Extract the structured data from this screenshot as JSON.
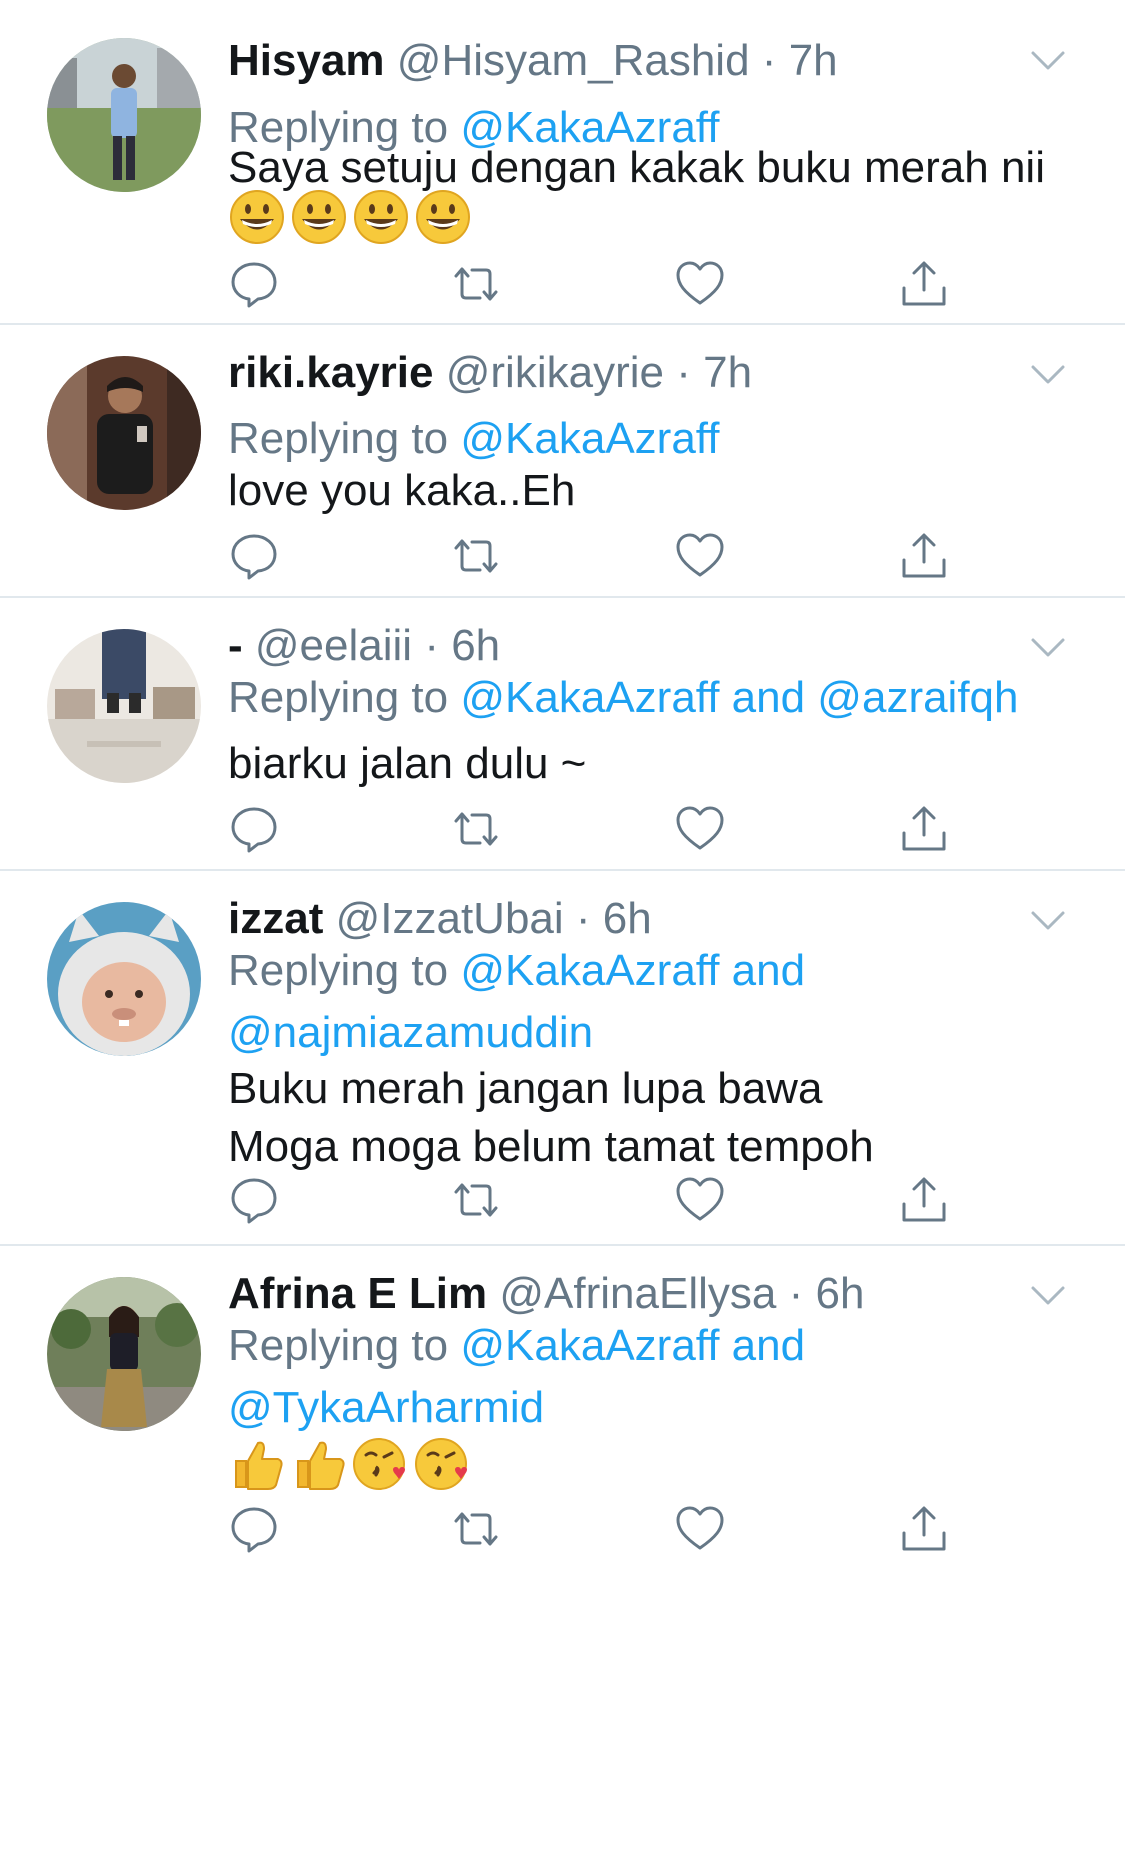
{
  "colors": {
    "link": "#1da1f2",
    "secondary_text": "#657786",
    "primary_text": "#14171a",
    "divider": "#e1e8ed"
  },
  "tweets": [
    {
      "name": "Hisyam",
      "handle": "@Hisyam_Rashid",
      "separator": "·",
      "time": "7h",
      "replying_prefix": "Replying to ",
      "mentions_line1": "@KakaAzraff",
      "mentions_line2": "",
      "text_lines": [
        "Saya setuju dengan kakak buku merah nii"
      ],
      "emojis": [
        "grinning-face-icon",
        "grinning-face-icon",
        "grinning-face-icon",
        "grinning-face-icon"
      ]
    },
    {
      "name": "riki.kayrie",
      "handle": "@rikikayrie",
      "separator": "·",
      "time": "7h",
      "replying_prefix": "Replying to ",
      "mentions_line1": "@KakaAzraff",
      "mentions_line2": "",
      "text_lines": [
        "love you kaka..Eh"
      ],
      "emojis": []
    },
    {
      "name": "-",
      "handle": "@eelaiii",
      "separator": "·",
      "time": "6h",
      "replying_prefix": "Replying to ",
      "mentions_line1": "@KakaAzraff and @azraifqh",
      "mentions_line2": "",
      "text_lines": [
        "biarku jalan dulu ~"
      ],
      "emojis": []
    },
    {
      "name": "izzat",
      "handle": "@IzzatUbai",
      "separator": "·",
      "time": "6h",
      "replying_prefix": "Replying to ",
      "mentions_line1": "@KakaAzraff and",
      "mentions_line2": "@najmiazamuddin",
      "text_lines": [
        "Buku merah jangan lupa bawa",
        "Moga moga belum tamat tempoh"
      ],
      "emojis": []
    },
    {
      "name": "Afrina E Lim",
      "handle": "@AfrinaEllysa",
      "separator": "·",
      "time": "6h",
      "replying_prefix": "Replying to ",
      "mentions_line1": "@KakaAzraff and",
      "mentions_line2": "@TykaArharmid",
      "text_lines": [],
      "emojis": [
        "thumbs-up-icon",
        "thumbs-up-icon",
        "face-blowing-kiss-icon",
        "face-blowing-kiss-icon"
      ]
    }
  ]
}
